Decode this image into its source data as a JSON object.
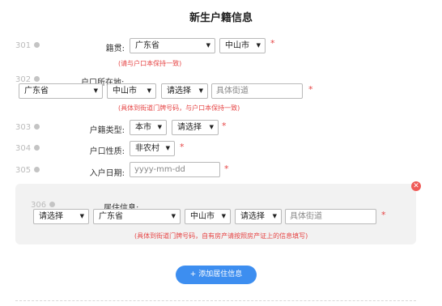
{
  "title": "新生户籍信息",
  "rows": {
    "native_place": {
      "num": "301",
      "label": "籍贯:",
      "province": "广东省",
      "city": "中山市",
      "hint": "(请与户口本保持一致)"
    },
    "registered_address": {
      "num": "302",
      "label": "户口所在地:",
      "province": "广东省",
      "city": "中山市",
      "district": "请选择",
      "street_placeholder": "具体街道",
      "hint": "(具体到街道门牌号码，与户口本保持一致)"
    },
    "household_type": {
      "num": "303",
      "label": "户籍类型:",
      "scope": "本市",
      "type": "请选择"
    },
    "household_nature": {
      "num": "304",
      "label": "户口性质:",
      "value": "非农村"
    },
    "registration_date": {
      "num": "305",
      "label": "入户日期:",
      "placeholder": "yyyy-mm-dd"
    }
  },
  "residence": {
    "num": "306",
    "label": "居住信息:",
    "country": "请选择",
    "province": "广东省",
    "city": "中山市",
    "district": "请选择",
    "street_placeholder": "具体街道",
    "hint": "(具体到街道门牌号码，自有房产请按照房产证上的信息填写)"
  },
  "required_mark": "*",
  "close_symbol": "✕",
  "add_button": "+ 添加居住信息",
  "colors": {
    "accent": "#3d8ef0",
    "required": "#e64545",
    "close": "#ef5a57",
    "panel": "#f2f2f2"
  }
}
